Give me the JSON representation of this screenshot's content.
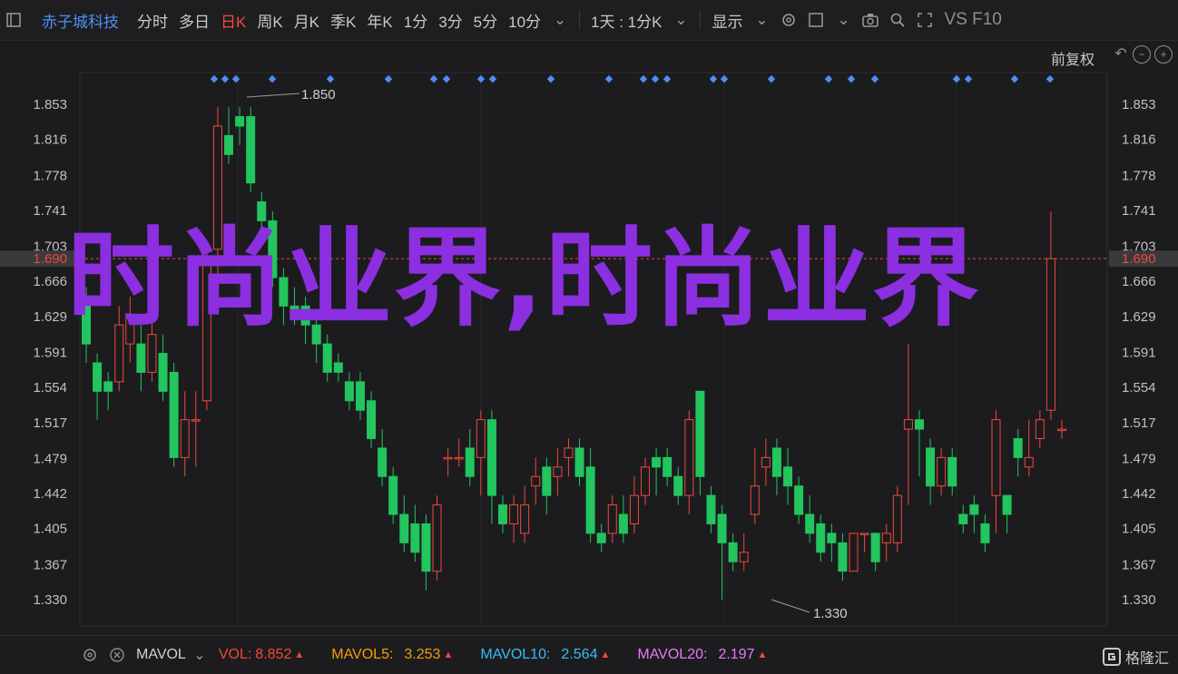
{
  "toolbar": {
    "stock_name": "赤子城科技",
    "periods": [
      "分时",
      "多日",
      "日K",
      "周K",
      "月K",
      "季K",
      "年K",
      "1分",
      "3分",
      "5分",
      "10分"
    ],
    "active_period": "日K",
    "interval_select": "1天 : 1分K",
    "display_label": "显示",
    "vs_label": "VS F10"
  },
  "chart": {
    "adjust_label": "前复权",
    "y_ticks": [
      "1.853",
      "1.816",
      "1.778",
      "1.741",
      "1.703",
      "1.666",
      "1.629",
      "1.591",
      "1.554",
      "1.517",
      "1.479",
      "1.442",
      "1.405",
      "1.367",
      "1.330"
    ],
    "current_price": "1.690",
    "high_label": "1.850",
    "low_label": "1.330",
    "colors": {
      "up": "#f0483c",
      "down": "#22c55e",
      "current_line": "#f0483c",
      "signal_dot": "#4f8ef7"
    }
  },
  "chart_data": {
    "type": "candlestick",
    "y_range": [
      1.31,
      1.87
    ],
    "candles": [
      [
        1.64,
        1.6,
        1.66,
        1.58
      ],
      [
        1.58,
        1.55,
        1.59,
        1.52
      ],
      [
        1.56,
        1.55,
        1.57,
        1.53
      ],
      [
        1.56,
        1.62,
        1.64,
        1.55
      ],
      [
        1.6,
        1.63,
        1.65,
        1.58
      ],
      [
        1.6,
        1.57,
        1.62,
        1.55
      ],
      [
        1.57,
        1.61,
        1.63,
        1.56
      ],
      [
        1.59,
        1.55,
        1.61,
        1.54
      ],
      [
        1.57,
        1.48,
        1.58,
        1.47
      ],
      [
        1.48,
        1.52,
        1.55,
        1.46
      ],
      [
        1.52,
        1.52,
        1.55,
        1.47
      ],
      [
        1.54,
        1.69,
        1.7,
        1.53
      ],
      [
        1.7,
        1.83,
        1.85,
        1.66
      ],
      [
        1.82,
        1.8,
        1.85,
        1.79
      ],
      [
        1.84,
        1.83,
        1.85,
        1.81
      ],
      [
        1.84,
        1.77,
        1.85,
        1.76
      ],
      [
        1.75,
        1.73,
        1.76,
        1.71
      ],
      [
        1.73,
        1.67,
        1.74,
        1.66
      ],
      [
        1.67,
        1.64,
        1.68,
        1.62
      ],
      [
        1.64,
        1.63,
        1.66,
        1.62
      ],
      [
        1.64,
        1.62,
        1.65,
        1.6
      ],
      [
        1.62,
        1.6,
        1.63,
        1.58
      ],
      [
        1.6,
        1.57,
        1.61,
        1.56
      ],
      [
        1.58,
        1.57,
        1.59,
        1.56
      ],
      [
        1.56,
        1.54,
        1.57,
        1.53
      ],
      [
        1.56,
        1.53,
        1.57,
        1.52
      ],
      [
        1.54,
        1.5,
        1.55,
        1.49
      ],
      [
        1.49,
        1.46,
        1.51,
        1.45
      ],
      [
        1.46,
        1.42,
        1.47,
        1.41
      ],
      [
        1.42,
        1.39,
        1.44,
        1.38
      ],
      [
        1.41,
        1.38,
        1.43,
        1.37
      ],
      [
        1.41,
        1.36,
        1.42,
        1.34
      ],
      [
        1.36,
        1.43,
        1.44,
        1.35
      ],
      [
        1.48,
        1.48,
        1.49,
        1.46
      ],
      [
        1.48,
        1.48,
        1.5,
        1.47
      ],
      [
        1.49,
        1.46,
        1.51,
        1.45
      ],
      [
        1.48,
        1.52,
        1.53,
        1.44
      ],
      [
        1.52,
        1.44,
        1.53,
        1.41
      ],
      [
        1.43,
        1.41,
        1.44,
        1.4
      ],
      [
        1.41,
        1.43,
        1.44,
        1.39
      ],
      [
        1.4,
        1.43,
        1.45,
        1.39
      ],
      [
        1.45,
        1.46,
        1.48,
        1.43
      ],
      [
        1.47,
        1.44,
        1.48,
        1.42
      ],
      [
        1.46,
        1.47,
        1.49,
        1.44
      ],
      [
        1.48,
        1.49,
        1.5,
        1.46
      ],
      [
        1.49,
        1.46,
        1.5,
        1.45
      ],
      [
        1.47,
        1.4,
        1.49,
        1.39
      ],
      [
        1.4,
        1.39,
        1.41,
        1.38
      ],
      [
        1.4,
        1.43,
        1.44,
        1.39
      ],
      [
        1.42,
        1.4,
        1.44,
        1.39
      ],
      [
        1.41,
        1.44,
        1.46,
        1.4
      ],
      [
        1.44,
        1.47,
        1.48,
        1.43
      ],
      [
        1.48,
        1.47,
        1.49,
        1.44
      ],
      [
        1.48,
        1.46,
        1.49,
        1.45
      ],
      [
        1.46,
        1.44,
        1.47,
        1.43
      ],
      [
        1.44,
        1.52,
        1.53,
        1.42
      ],
      [
        1.55,
        1.46,
        1.55,
        1.44
      ],
      [
        1.44,
        1.41,
        1.45,
        1.4
      ],
      [
        1.42,
        1.39,
        1.43,
        1.33
      ],
      [
        1.39,
        1.37,
        1.4,
        1.36
      ],
      [
        1.37,
        1.38,
        1.4,
        1.36
      ],
      [
        1.42,
        1.45,
        1.49,
        1.41
      ],
      [
        1.47,
        1.48,
        1.5,
        1.45
      ],
      [
        1.49,
        1.46,
        1.5,
        1.44
      ],
      [
        1.47,
        1.45,
        1.49,
        1.43
      ],
      [
        1.45,
        1.42,
        1.46,
        1.41
      ],
      [
        1.42,
        1.4,
        1.44,
        1.39
      ],
      [
        1.41,
        1.38,
        1.42,
        1.37
      ],
      [
        1.4,
        1.39,
        1.41,
        1.37
      ],
      [
        1.39,
        1.36,
        1.4,
        1.35
      ],
      [
        1.36,
        1.4,
        1.4,
        1.36
      ],
      [
        1.4,
        1.4,
        1.4,
        1.38
      ],
      [
        1.4,
        1.37,
        1.4,
        1.36
      ],
      [
        1.39,
        1.4,
        1.41,
        1.37
      ],
      [
        1.39,
        1.44,
        1.45,
        1.38
      ],
      [
        1.51,
        1.52,
        1.6,
        1.43
      ],
      [
        1.52,
        1.51,
        1.53,
        1.46
      ],
      [
        1.49,
        1.45,
        1.5,
        1.43
      ],
      [
        1.45,
        1.48,
        1.49,
        1.44
      ],
      [
        1.48,
        1.45,
        1.49,
        1.44
      ],
      [
        1.42,
        1.41,
        1.43,
        1.4
      ],
      [
        1.43,
        1.42,
        1.44,
        1.4
      ],
      [
        1.41,
        1.39,
        1.42,
        1.38
      ],
      [
        1.44,
        1.52,
        1.53,
        1.4
      ],
      [
        1.44,
        1.42,
        1.44,
        1.4
      ],
      [
        1.5,
        1.48,
        1.51,
        1.46
      ],
      [
        1.47,
        1.48,
        1.52,
        1.46
      ],
      [
        1.5,
        1.52,
        1.53,
        1.49
      ],
      [
        1.53,
        1.69,
        1.74,
        1.52
      ],
      [
        1.51,
        1.51,
        1.52,
        1.5
      ]
    ]
  },
  "bottom": {
    "mavol_label": "MAVOL",
    "vol_label": "VOL:",
    "vol_value": "8.852",
    "mavol5_label": "MAVOL5:",
    "mavol5_value": "3.253",
    "mavol10_label": "MAVOL10:",
    "mavol10_value": "2.564",
    "mavol20_label": "MAVOL20:",
    "mavol20_value": "2.197",
    "colors": {
      "vol": "#f0483c",
      "mavol5": "#f59e0b",
      "mavol10": "#38bdf8",
      "mavol20": "#e879f9"
    }
  },
  "watermark": "时尚业界,时尚业界",
  "logo_text": "格隆汇"
}
